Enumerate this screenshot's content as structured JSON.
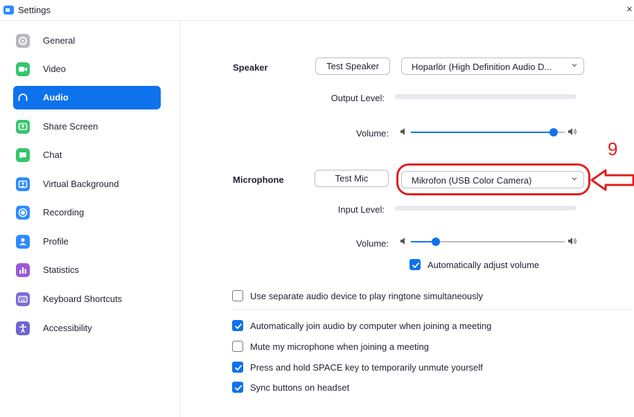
{
  "window": {
    "title": "Settings",
    "close_glyph": "×"
  },
  "sidebar": {
    "items": [
      {
        "label": "General",
        "icon": "gear-icon",
        "color": "#b7b7c0",
        "active": false
      },
      {
        "label": "Video",
        "icon": "video-camera-icon",
        "color": "#35c66b",
        "active": false
      },
      {
        "label": "Audio",
        "icon": "headphones-icon",
        "color": "#0e72ed",
        "active": true
      },
      {
        "label": "Share Screen",
        "icon": "share-screen-icon",
        "color": "#35c66b",
        "active": false
      },
      {
        "label": "Chat",
        "icon": "chat-bubble-icon",
        "color": "#35c66b",
        "active": false
      },
      {
        "label": "Virtual Background",
        "icon": "virtual-background-icon",
        "color": "#2d8cff",
        "active": false
      },
      {
        "label": "Recording",
        "icon": "record-icon",
        "color": "#2d8cff",
        "active": false
      },
      {
        "label": "Profile",
        "icon": "profile-icon",
        "color": "#2d8cff",
        "active": false
      },
      {
        "label": "Statistics",
        "icon": "statistics-icon",
        "color": "#9b59d9",
        "active": false
      },
      {
        "label": "Keyboard Shortcuts",
        "icon": "keyboard-icon",
        "color": "#7d6bd6",
        "active": false
      },
      {
        "label": "Accessibility",
        "icon": "accessibility-icon",
        "color": "#6f63d4",
        "active": false
      }
    ]
  },
  "speaker": {
    "label": "Speaker",
    "test_button": "Test Speaker",
    "device": "Hoparlör (High Definition Audio D...",
    "output_level_label": "Output Level:",
    "volume_label": "Volume:",
    "volume_fraction": 0.93
  },
  "microphone": {
    "label": "Microphone",
    "test_button": "Test Mic",
    "device": "Mikrofon (USB Color Camera)",
    "input_level_label": "Input Level:",
    "volume_label": "Volume:",
    "volume_fraction": 0.16,
    "auto_adjust_label": "Automatically adjust volume",
    "auto_adjust_checked": true
  },
  "options": [
    {
      "label": "Use separate audio device to play ringtone simultaneously",
      "checked": false
    },
    {
      "label": "Automatically join audio by computer when joining a meeting",
      "checked": true
    },
    {
      "label": "Mute my microphone when joining a meeting",
      "checked": false
    },
    {
      "label": "Press and hold SPACE key to temporarily unmute yourself",
      "checked": true
    },
    {
      "label": "Sync buttons on headset",
      "checked": true
    }
  ],
  "annotation": {
    "number": "9",
    "color": "#e01d1d"
  },
  "colors": {
    "accent": "#0e72ed",
    "track": "#bcbcc4",
    "annotation": "#e01d1d"
  }
}
